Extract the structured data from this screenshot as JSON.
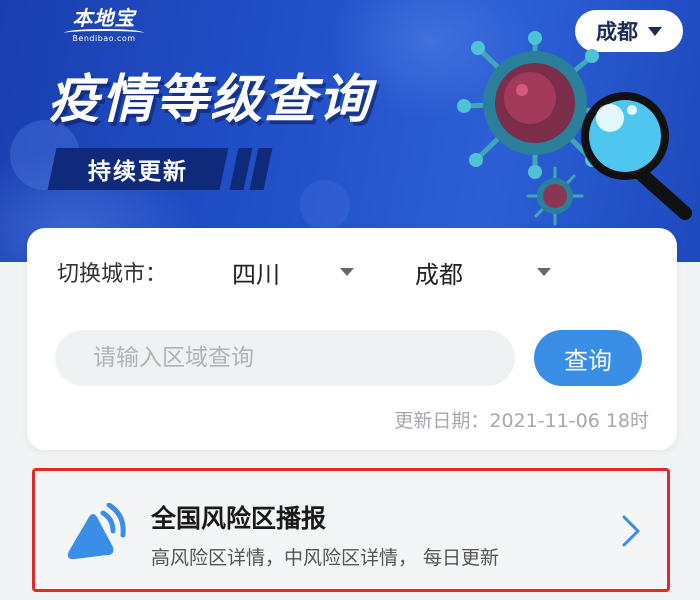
{
  "banner": {
    "logo_name": "本地宝",
    "logo_domain": "Bendibao.com",
    "city_selector": "成都",
    "title": "疫情等级查询",
    "subtitle": "持续更新",
    "colors": {
      "background": "#2150c8",
      "accent_dark": "#0f2a7a"
    }
  },
  "query": {
    "switch_city_label": "切换城市：",
    "province": "四川",
    "city": "成都",
    "search_placeholder": "请输入区域查询",
    "search_button": "查询",
    "update_date": "更新日期：2021-11-06 18时",
    "colors": {
      "button": "#3a8ee6"
    }
  },
  "broadcast": {
    "title": "全国风险区播报",
    "description": "高风险区详情，中风险区详情， 每日更新",
    "icon": "broadcast-icon",
    "colors": {
      "highlight_border": "#e02a2a"
    }
  }
}
